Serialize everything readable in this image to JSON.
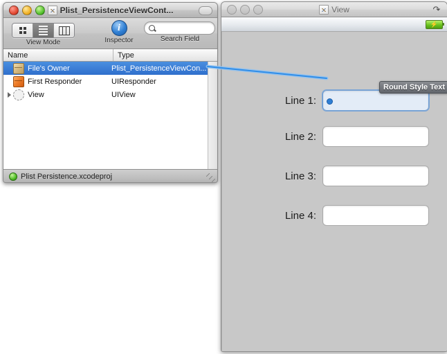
{
  "ib_window": {
    "title": "Plist_PersistenceViewCont...",
    "proxy_icon": "document-icon",
    "traffic": {
      "close": "close-button",
      "minimize": "minimize-button",
      "zoom": "zoom-button"
    },
    "toolbar": {
      "view_mode_label": "View Mode",
      "inspector_label": "Inspector",
      "inspector_glyph": "i",
      "search_label": "Search Field",
      "search_value": "",
      "search_placeholder": "",
      "segments": [
        {
          "name": "icon-view",
          "selected": false
        },
        {
          "name": "list-view",
          "selected": true
        },
        {
          "name": "column-view",
          "selected": false
        }
      ]
    },
    "table": {
      "columns": [
        "Name",
        "Type"
      ],
      "rows": [
        {
          "name": "File's Owner",
          "type": "Plist_PersistenceViewCon...",
          "icon": "cube-tan-icon",
          "selected": true,
          "disclosure": false
        },
        {
          "name": "First Responder",
          "type": "UIResponder",
          "icon": "cube-orange-icon",
          "selected": false,
          "disclosure": false
        },
        {
          "name": "View",
          "type": "UIView",
          "icon": "dashed-circle-icon",
          "selected": false,
          "disclosure": true
        }
      ]
    },
    "statusbar": {
      "text": "Plist Persistence.xcodeproj",
      "dot": "green-status-dot"
    }
  },
  "view_window": {
    "title": "View",
    "proxy_icon": "document-icon",
    "rotate_button": "↷",
    "sim_statusbar": {
      "battery": "battery-charging-icon",
      "bolt": "⚡"
    },
    "form_rows": [
      {
        "label": "Line 1:",
        "value": "",
        "selected": true
      },
      {
        "label": "Line 2:",
        "value": "",
        "selected": false
      },
      {
        "label": "Line 3:",
        "value": "",
        "selected": false
      },
      {
        "label": "Line 4:",
        "value": "",
        "selected": false
      }
    ],
    "tooltip": {
      "text": "Round Style Text"
    }
  },
  "colors": {
    "selection_blue": "#2f6fcc",
    "connection_line": "#3d92e8",
    "canvas_gray": "#c8c8c8",
    "tooltip_gray": "#62666c"
  }
}
